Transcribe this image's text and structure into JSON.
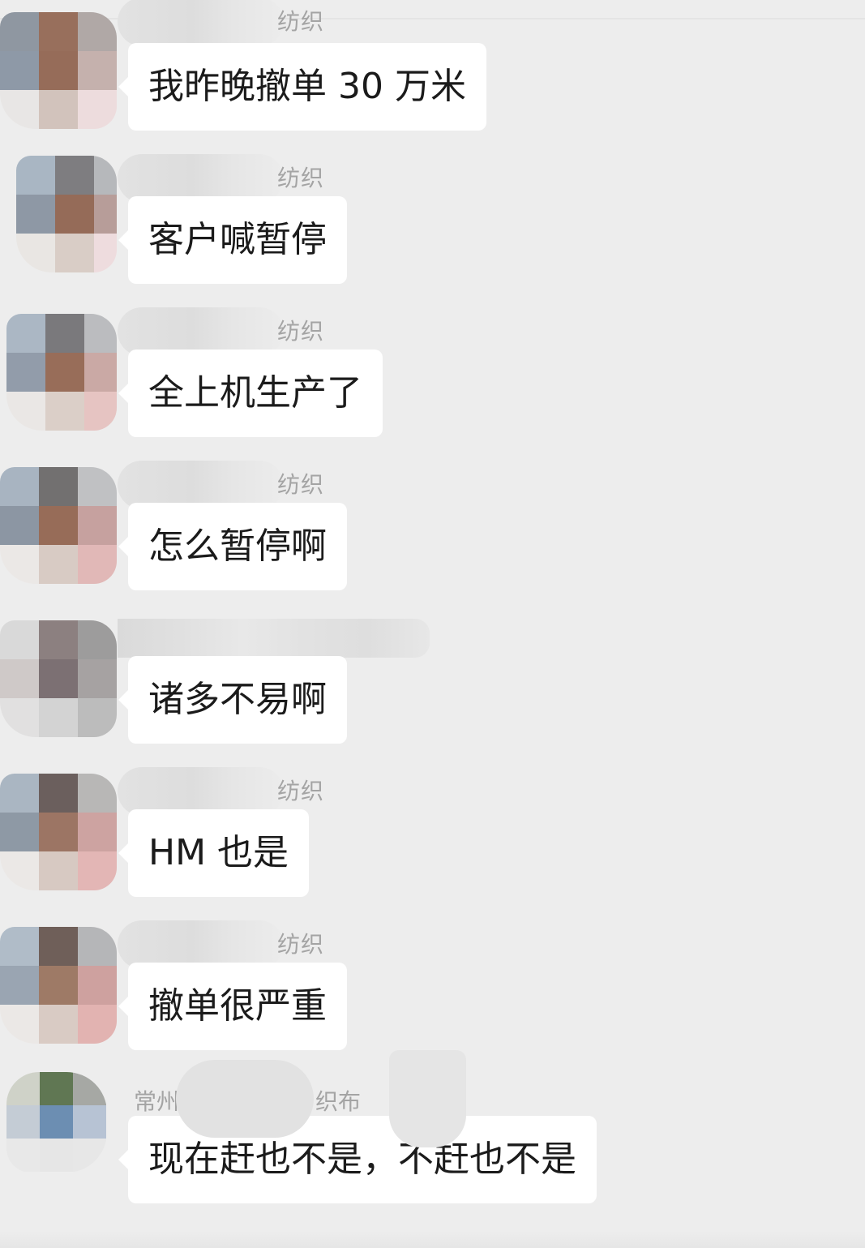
{
  "chat": {
    "messages": [
      {
        "sender_suffix": "纺织",
        "text": "我昨晚撤单 30 万米",
        "avatar": [
          "#8f97a2",
          "#9a6f5b",
          "#b0a8a6",
          "#8d99a8",
          "#986c58",
          "#c6b1ad",
          "#e8e6e5",
          "#d3c3bb",
          "#eedcdd"
        ]
      },
      {
        "sender_suffix": "纺织",
        "text": "客户喊暂停",
        "avatar": [
          "#a8b6c4",
          "#7e7d80",
          "#b6b8bb",
          "#8e98a6",
          "#976b57",
          "#b89d98",
          "#e9e6e3",
          "#dacdc6",
          "#efdcde"
        ]
      },
      {
        "sender_suffix": "纺织",
        "text": "全上机生产了",
        "avatar": [
          "#aab7c5",
          "#7a797c",
          "#bbbcbf",
          "#929cab",
          "#9a6d58",
          "#cba9a4",
          "#eae7e5",
          "#dccfc8",
          "#e7c4c2"
        ]
      },
      {
        "sender_suffix": "纺织",
        "text": "怎么暂停啊",
        "avatar": [
          "#a7b4c2",
          "#727070",
          "#c0c1c3",
          "#8c96a4",
          "#996c57",
          "#c8a19e",
          "#ebe8e6",
          "#d9cbc3",
          "#e3b8b6"
        ]
      },
      {
        "sender_suffix": "",
        "text": "诸多不易啊",
        "avatar": [
          "#d9d9d9",
          "#8c8080",
          "#9d9c9c",
          "#cfc9c8",
          "#7c7073",
          "#a6a2a2",
          "#e1e0e0",
          "#d3d3d3",
          "#bcbcbc"
        ]
      },
      {
        "sender_suffix": "纺织",
        "text": "HM 也是",
        "avatar": [
          "#a9b6c3",
          "#6b5f5d",
          "#b8b7b6",
          "#8e99a6",
          "#9e7563",
          "#cfa3a0",
          "#ebe8e6",
          "#d8c9c2",
          "#e5b6b4"
        ]
      },
      {
        "sender_suffix": "纺织",
        "text": "撤单很严重",
        "avatar": [
          "#afbcc9",
          "#705f58",
          "#b5b6b8",
          "#9aa5b3",
          "#a07a65",
          "#d0a19e",
          "#ebe8e6",
          "#dacbc4",
          "#e4b2b0"
        ]
      }
    ],
    "last_message": {
      "sender_prefix": "常州",
      "sender_suffix": "织布",
      "text": "现在赶也不是，不赶也不是",
      "avatar": [
        "#cfd2c8",
        "#5f7751",
        "#a6a8a4",
        "#c4ccd6",
        "#6a8eb4",
        "#b6c3d5",
        "#e8e8e8",
        "#e6e6e6",
        "#e7e7e7"
      ]
    }
  }
}
